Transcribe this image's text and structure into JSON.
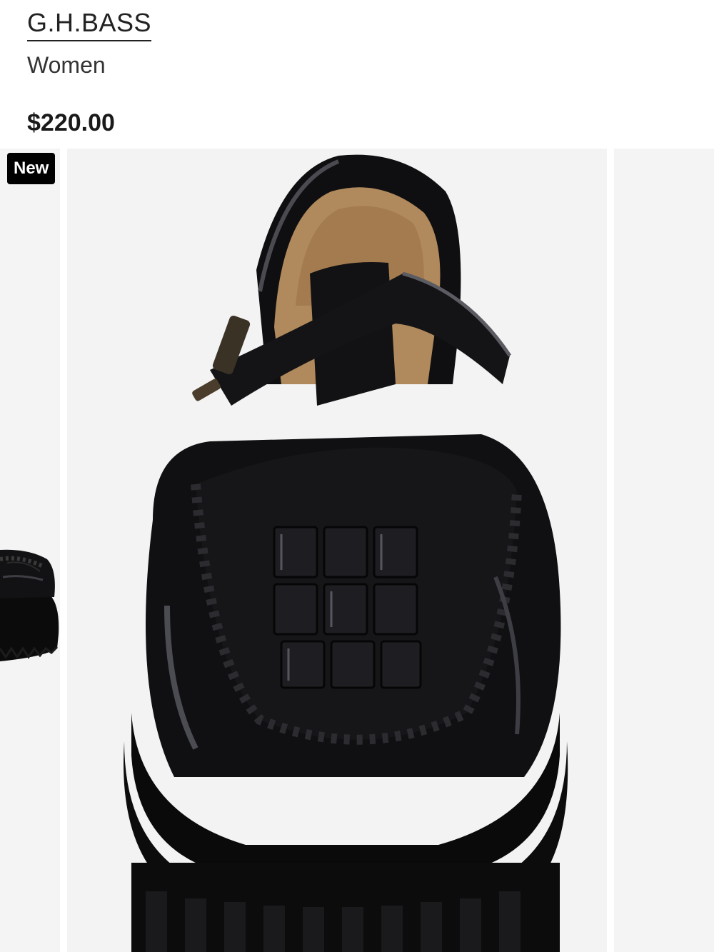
{
  "product": {
    "brand": "G.H.BASS",
    "category": "Women",
    "price": "$220.00",
    "badge": "New"
  },
  "gallery": {
    "images": [
      {
        "name": "shoe-side-view-partial"
      },
      {
        "name": "shoe-front-view"
      },
      {
        "name": "next-image-partial"
      }
    ]
  },
  "colors": {
    "badge_bg": "#000000",
    "badge_text": "#ffffff",
    "image_bg": "#f3f3f3",
    "shoe": "#0d0d0f",
    "lining": "#b08a60"
  }
}
